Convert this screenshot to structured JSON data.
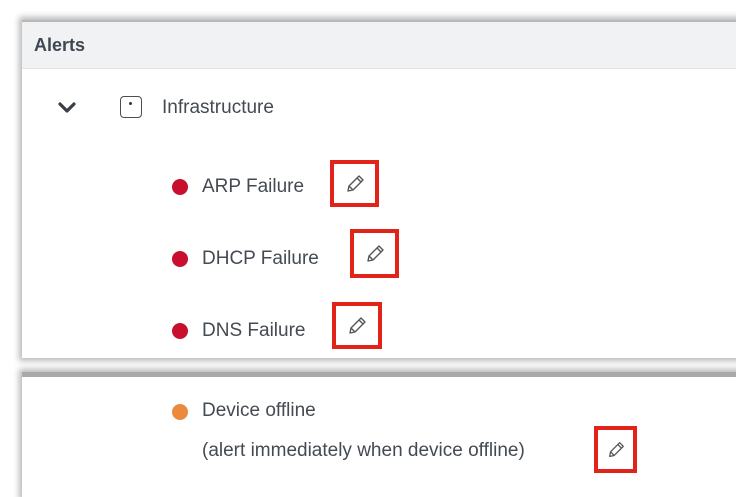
{
  "alerts_panel": {
    "title": "Alerts",
    "group": {
      "label": "Infrastructure",
      "expanded": true,
      "items": [
        {
          "label": "ARP Failure",
          "severity": "critical",
          "color": "#c8102e",
          "icon": "pencil-icon"
        },
        {
          "label": "DHCP Failure",
          "severity": "critical",
          "color": "#c8102e",
          "icon": "pencil-icon"
        },
        {
          "label": "DNS Failure",
          "severity": "critical",
          "color": "#c8102e",
          "icon": "pencil-icon"
        }
      ]
    }
  },
  "device_offline": {
    "label": "Device offline",
    "detail": "(alert immediately when device offline)",
    "color": "#eb8a3c",
    "icon": "pencil-icon"
  },
  "highlight_color": "#e2231a"
}
